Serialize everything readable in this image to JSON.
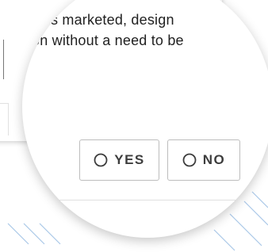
{
  "question": {
    "line1": "s marketed, design",
    "line2": "on without a need to be"
  },
  "answers": {
    "yes_label": "YES",
    "no_label": "NO"
  },
  "colors": {
    "text": "#212121",
    "button_border": "#bdbdbd",
    "button_text": "#3d3d3d",
    "hatch": "#aac8e8"
  },
  "icons": {
    "radio": "radio-unchecked-icon"
  }
}
